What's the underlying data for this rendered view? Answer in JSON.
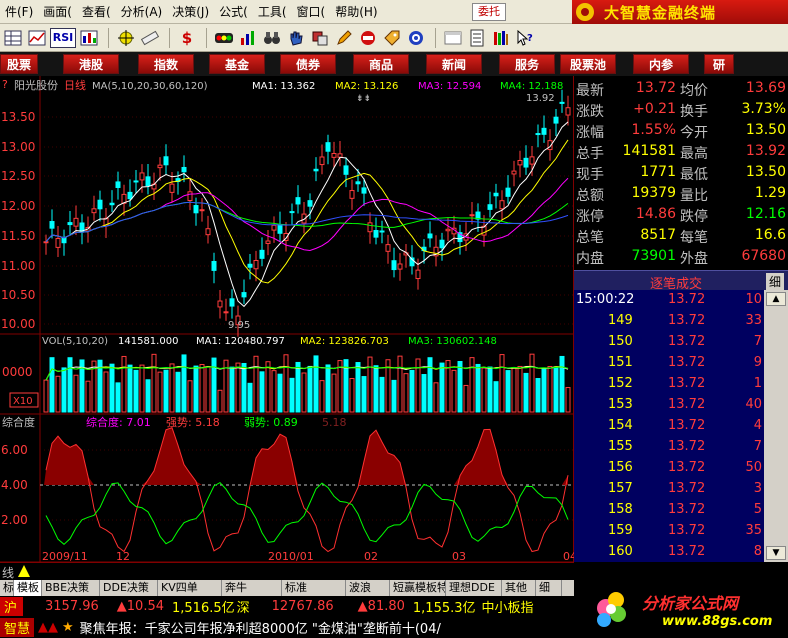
{
  "menu": {
    "items": [
      {
        "label": "件(F)",
        "key": "F"
      },
      {
        "label": "画面(",
        "key": ""
      },
      {
        "label": "查看(",
        "key": ""
      },
      {
        "label": "分析(A)",
        "key": "A"
      },
      {
        "label": "决策(J)",
        "key": "J"
      },
      {
        "label": "公式(",
        "key": ""
      },
      {
        "label": "工具(",
        "key": ""
      },
      {
        "label": "窗口(",
        "key": ""
      },
      {
        "label": "帮助(H)",
        "key": "H"
      }
    ],
    "weituo": "委托",
    "brand": "大智慧金融终端"
  },
  "toolbar": {
    "icons": [
      "grid-icon",
      "chart-icon",
      "rsi-icon",
      "compare-icon",
      "crosshair-icon",
      "ruler-icon",
      "dollar-icon",
      "traffic-icon",
      "bars-icon",
      "binoculars-icon",
      "hand-icon",
      "dice-icon",
      "pen-icon",
      "stop-icon",
      "tag-icon",
      "target-icon",
      "window-icon",
      "doc-icon",
      "bookshelf-icon",
      "help-cursor-icon"
    ],
    "rsi_label": "RSI",
    "dollar_label": "$"
  },
  "categories": [
    "股票",
    "港股",
    "指数",
    "基金",
    "债券",
    "商品",
    "新闻",
    "服务",
    "股票池",
    "内参",
    "研"
  ],
  "chart": {
    "title_name": "阳光股份",
    "period": "日线",
    "ma_header": "MA(5,10,20,30,60,120)",
    "ma1": "MA1: 13.362",
    "ma2": "MA2: 13.126",
    "ma3": "MA3: 12.594",
    "ma4": "MA4: 12.188",
    "high_label": "13.92",
    "low_label": "9.95",
    "price_ticks": [
      "13.50",
      "13.00",
      "12.50",
      "12.00",
      "11.50",
      "11.00",
      "10.50",
      "10.00"
    ],
    "vol_header": "VOL(5,10,20)",
    "vol_value": "141581.000",
    "vol_ma1": "MA1: 120480.797",
    "vol_ma2": "MA2: 123826.703",
    "vol_ma3": "MA3: 130602.148",
    "vol_tick": "0000",
    "vol_unit": "X10",
    "osc_name": "综合度",
    "osc_main": "综合度: 7.01",
    "osc_strong": "强势: 5.18",
    "osc_weak": "弱势: 0.89",
    "osc_extra": "5.18",
    "osc_ticks": [
      "6.00",
      "4.00",
      "2.00"
    ],
    "date_labels": [
      "2009/11",
      "12",
      "2010/01",
      "02",
      "03",
      "04"
    ],
    "corner_label": "线"
  },
  "quote": {
    "rows": [
      {
        "l1": "最新",
        "v1": "13.72",
        "l2": "均价",
        "v2": "13.69",
        "c1": "#ff3c3c",
        "c2": "#ff3c3c"
      },
      {
        "l1": "涨跌",
        "v1": "+0.21",
        "l2": "换手",
        "v2": "3.73%",
        "c1": "#ff3c3c",
        "c2": "#ffff00"
      },
      {
        "l1": "涨幅",
        "v1": "1.55%",
        "l2": "今开",
        "v2": "13.50",
        "c1": "#ff3c3c",
        "c2": "#ffff00"
      },
      {
        "l1": "总手",
        "v1": "141581",
        "l2": "最高",
        "v2": "13.92",
        "c1": "#ffff00",
        "c2": "#ff3c3c"
      },
      {
        "l1": "现手",
        "v1": "1771",
        "l2": "最低",
        "v2": "13.50",
        "c1": "#ffff00",
        "c2": "#ffff00"
      },
      {
        "l1": "总额",
        "v1": "19379",
        "l2": "量比",
        "v2": "1.29",
        "c1": "#ffff00",
        "c2": "#ffff00"
      },
      {
        "l1": "涨停",
        "v1": "14.86",
        "l2": "跌停",
        "v2": "12.16",
        "c1": "#ff3c3c",
        "c2": "#00ff00"
      },
      {
        "l1": "总笔",
        "v1": "8517",
        "l2": "每笔",
        "v2": "16.6",
        "c1": "#ffff00",
        "c2": "#ffff00"
      },
      {
        "l1": "内盘",
        "v1": "73901",
        "l2": "外盘",
        "v2": "67680",
        "c1": "#00ff00",
        "c2": "#ff3c3c"
      }
    ]
  },
  "ticks": {
    "header": "逐笔成交",
    "header_side": "细",
    "rows": [
      {
        "time": "15:00:22",
        "price": "13.72",
        "vol": "10"
      },
      {
        "time": "149",
        "price": "13.72",
        "vol": "33"
      },
      {
        "time": "150",
        "price": "13.72",
        "vol": "7"
      },
      {
        "time": "151",
        "price": "13.72",
        "vol": "9"
      },
      {
        "time": "152",
        "price": "13.72",
        "vol": "1"
      },
      {
        "time": "153",
        "price": "13.72",
        "vol": "40"
      },
      {
        "time": "154",
        "price": "13.72",
        "vol": "4"
      },
      {
        "time": "155",
        "price": "13.72",
        "vol": "7"
      },
      {
        "time": "156",
        "price": "13.72",
        "vol": "50"
      },
      {
        "time": "157",
        "price": "13.72",
        "vol": "3"
      },
      {
        "time": "158",
        "price": "13.72",
        "vol": "5"
      },
      {
        "time": "159",
        "price": "13.72",
        "vol": "35"
      },
      {
        "time": "160",
        "price": "13.72",
        "vol": "8"
      }
    ]
  },
  "bottom_tabs": [
    "标",
    "模板",
    "BBE决策",
    "DDE决策",
    "KV四单",
    "奔牛",
    "标准",
    "波浪",
    "短赢模板特价",
    "理想DDE",
    "其他",
    "细"
  ],
  "market": {
    "sh_label": "沪",
    "sh_index": "3157.96",
    "sh_change": "▲10.54",
    "sh_amount": "1,516.5亿",
    "sz_label": "深",
    "sz_index": "12767.86",
    "sz_change": "▲81.80",
    "sz_amount": "1,155.3亿",
    "board_label": "中小板指"
  },
  "news": {
    "prefix": "智慧",
    "text": "聚焦年报：千家公司年报净利超8000亿 \"金煤油\"垄断前十(04/"
  },
  "promo": {
    "title": "分析家公式网",
    "url": "www.88gs.com"
  },
  "colors": {
    "up": "#ff3c3c",
    "down": "#00ffff",
    "label": "#c0c0c0",
    "yellow": "#ffff00"
  }
}
